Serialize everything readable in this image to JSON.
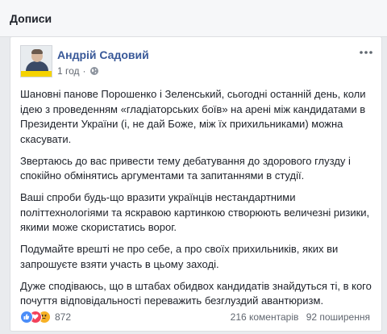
{
  "section": {
    "title": "Дописи"
  },
  "post": {
    "author": "Андрій Садовий",
    "time": "1 год",
    "meta_separator": "·",
    "paragraphs": [
      "Шановні панове Порошенко і Зеленський, сьогодні останній день, коли ідею з проведенням «гладіаторських боїв» на арені між кандидатами в Президенти України (і, не дай Боже, між їх прихильниками) можна скасувати.",
      "Звертаюсь до вас привести тему дебатування до здорового глузду і спокійно обмінятись аргументами та запитаннями в студії.",
      "Ваші спроби будь-що вразити українців нестандартними політтехнологіями та яскравою картинкою створюють величезні ризики, якими може скористатись ворог.",
      "Подумайте врешті не про себе, а про своїх прихильників, яких ви запрошуєте взяти участь в цьому заході.",
      "Дуже сподіваюсь, що в штабах обидвох кандидатів знайдуться ті, в кого почуття відповідальності переважить безглуздий авантюризм."
    ],
    "reactions": {
      "count": "872",
      "types": [
        "like-icon",
        "love-icon",
        "angry-icon"
      ]
    },
    "comments": "216 коментарів",
    "shares": "92 поширення"
  },
  "colors": {
    "link": "#385898",
    "like": "#4b8df8",
    "love": "#f2415a",
    "angry": "#f7b125"
  }
}
